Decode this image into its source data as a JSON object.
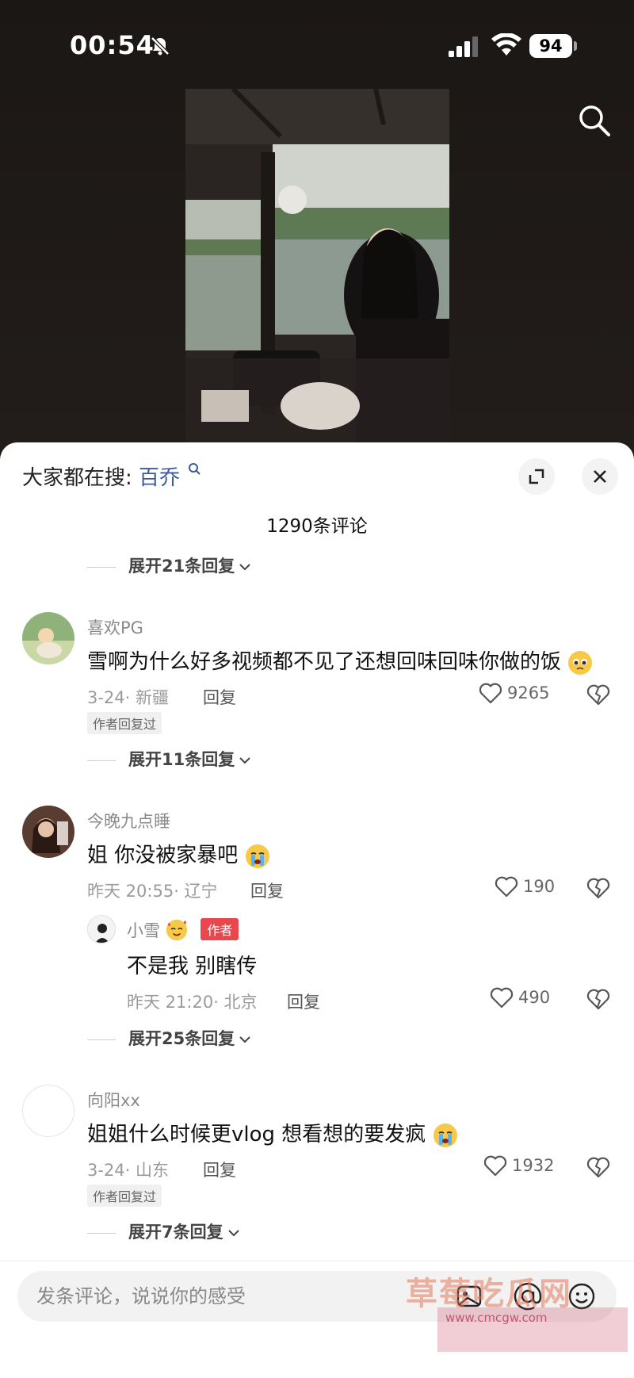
{
  "status_bar": {
    "time": "00:54",
    "battery": "94"
  },
  "sheet": {
    "search_prefix": "大家都在搜:",
    "search_keyword": "百乔",
    "comment_count": "1290条评论",
    "top_expand": "展开21条回复"
  },
  "comments": [
    {
      "username": "喜欢PG",
      "text": "雪啊为什么好多视频都不见了还想回味回味你做的饭",
      "meta": "3-24· 新疆",
      "reply": "回复",
      "likes": "9265",
      "badge": "作者回复过",
      "expand": "展开11条回复"
    },
    {
      "username": "今晚九点睡",
      "text": "姐 你没被家暴吧",
      "meta": "昨天 20:55· 辽宁",
      "reply": "回复",
      "likes": "190",
      "sub_reply": {
        "username": "小雪",
        "author_tag": "作者",
        "text": "不是我 别瞎传",
        "meta": "昨天 21:20· 北京",
        "reply": "回复",
        "likes": "490"
      },
      "expand": "展开25条回复"
    },
    {
      "username": "向阳xx",
      "text": "姐姐什么时候更vlog  想看想的要发疯",
      "meta": "3-24· 山东",
      "reply": "回复",
      "likes": "1932",
      "badge": "作者回复过",
      "expand": "展开7条回复"
    }
  ],
  "input": {
    "placeholder": "发条评论，说说你的感受"
  },
  "watermark": {
    "main": "草莓吃瓜网",
    "url": "www.cmcgw.com"
  }
}
